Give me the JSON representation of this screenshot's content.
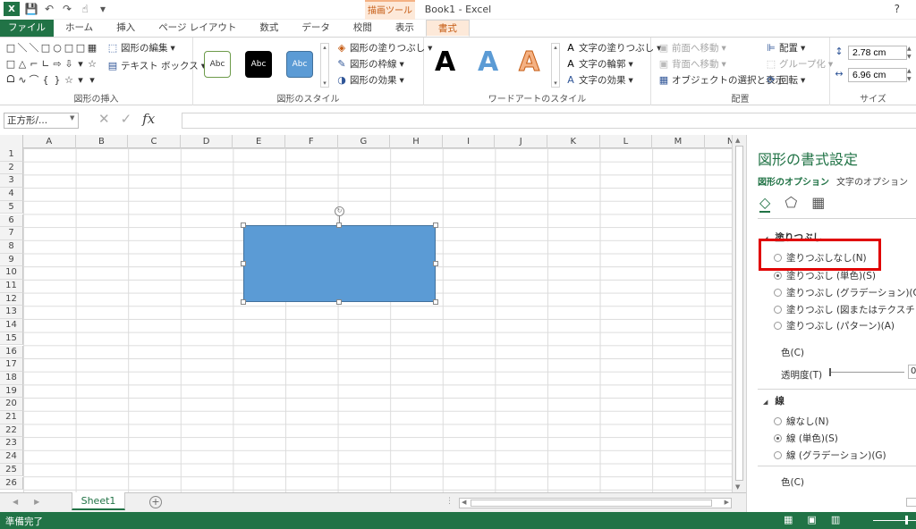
{
  "title_bar": {
    "app_logo": "X",
    "doc_title": "Book1 - Excel",
    "context_group": "描画ツール",
    "help_glyph": "?"
  },
  "tabs": [
    {
      "label": "ファイル"
    },
    {
      "label": "ホーム"
    },
    {
      "label": "挿入"
    },
    {
      "label": "ページ レイアウト"
    },
    {
      "label": "数式"
    },
    {
      "label": "データ"
    },
    {
      "label": "校閲"
    },
    {
      "label": "表示"
    },
    {
      "label": "書式"
    }
  ],
  "ribbon": {
    "insert_shapes": {
      "label": "図形の挿入",
      "edit_shape": "図形の編集",
      "text_box": "テキスト ボックス",
      "shape_glyphs": [
        "□",
        "＼",
        "＼",
        "□",
        "○",
        "□",
        "□",
        "▦",
        "□",
        "△",
        "⌐",
        "∟",
        "⇨",
        "⇩",
        "▾",
        "☆",
        "ᗝ",
        "∿",
        "⌒",
        "{",
        "}",
        "☆",
        "▾",
        "▾"
      ]
    },
    "shape_styles": {
      "label": "図形のスタイル",
      "sample": "Abc",
      "fill": "図形の塗りつぶし",
      "outline": "図形の枠線",
      "effects": "図形の効果"
    },
    "wordart": {
      "label": "ワードアートのスタイル",
      "letter": "A",
      "text_fill": "文字の塗りつぶし",
      "text_outline": "文字の輪郭",
      "text_effects": "文字の効果"
    },
    "arrange": {
      "label": "配置",
      "bring_forward": "前面へ移動",
      "send_backward": "背面へ移動",
      "selection_pane": "オブジェクトの選択と表示",
      "align": "配置",
      "group": "グループ化",
      "rotate": "回転"
    },
    "size": {
      "label": "サイズ",
      "height": "2.78 cm",
      "width": "6.96 cm"
    }
  },
  "formula_bar": {
    "name_box": "正方形/...",
    "cancel_glyph": "✕",
    "enter_glyph": "✓",
    "fx_glyph": "fx",
    "value": ""
  },
  "grid": {
    "columns": [
      "A",
      "B",
      "C",
      "D",
      "E",
      "F",
      "G",
      "H",
      "I",
      "J",
      "K",
      "L",
      "M",
      "N"
    ],
    "rows": [
      "1",
      "2",
      "3",
      "4",
      "5",
      "6",
      "7",
      "8",
      "9",
      "10",
      "11",
      "12",
      "13",
      "14",
      "15",
      "16",
      "17",
      "18",
      "19",
      "20",
      "21",
      "22",
      "23",
      "24",
      "25",
      "26"
    ],
    "shape_color": "#5b9bd5"
  },
  "sheets": {
    "active": "Sheet1"
  },
  "status": {
    "text": "準備完了"
  },
  "format_pane": {
    "title": "図形の書式設定",
    "tab_shape": "図形のオプション",
    "tab_text": "文字のオプション",
    "fill_section": "塗りつぶし",
    "fill_options": [
      {
        "label": "塗りつぶしなし(N)",
        "checked": false
      },
      {
        "label": "塗りつぶし (単色)(S)",
        "checked": true
      },
      {
        "label": "塗りつぶし (グラデーション)(G)",
        "checked": false
      },
      {
        "label": "塗りつぶし (図またはテクスチャ)(P)",
        "checked": false
      },
      {
        "label": "塗りつぶし (パターン)(A)",
        "checked": false
      }
    ],
    "color_label": "色(C)",
    "transparency_label": "透明度(T)",
    "transparency_value": "0",
    "line_section": "線",
    "line_options": [
      {
        "label": "線なし(N)",
        "checked": false
      },
      {
        "label": "線 (単色)(S)",
        "checked": true
      },
      {
        "label": "線 (グラデーション)(G)",
        "checked": false
      }
    ],
    "line_color_label": "色(C)",
    "highlight_color": "#e00000"
  },
  "colors": {
    "brand": "#217346",
    "context_accent": "#c55a11"
  }
}
